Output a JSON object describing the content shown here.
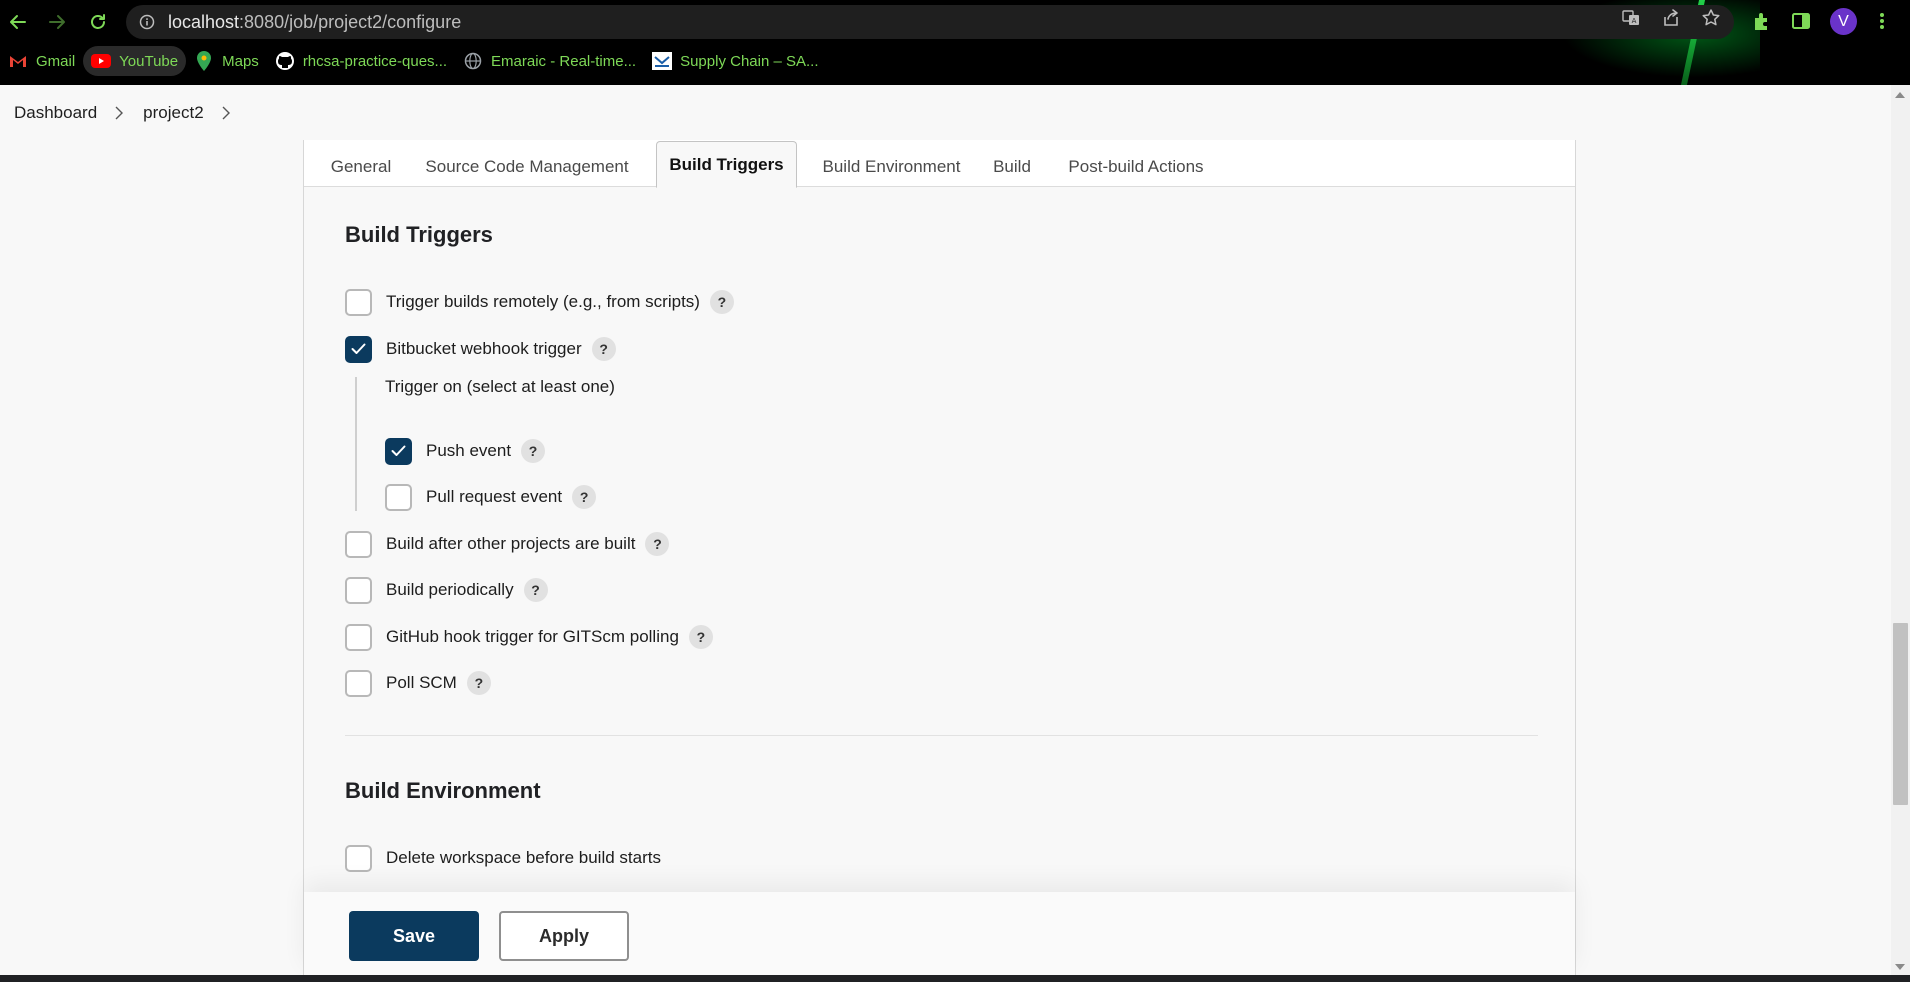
{
  "browser": {
    "url_host": "localhost",
    "url_rest": ":8080/job/project2/configure",
    "avatar_letter": "V",
    "icons": [
      "back-arrow-icon",
      "forward-arrow-icon",
      "reload-icon",
      "info-icon",
      "translate-icon",
      "share-icon",
      "star-icon",
      "extensions-icon",
      "side-panel-icon",
      "menu-kebab-icon"
    ],
    "accent_color": "#7ed957"
  },
  "bookmarks": [
    {
      "label": "Gmail",
      "icon": "gmail-icon"
    },
    {
      "label": "YouTube",
      "icon": "youtube-icon"
    },
    {
      "label": "Maps",
      "icon": "maps-pin-icon"
    },
    {
      "label": "rhcsa-practice-ques...",
      "icon": "github-icon"
    },
    {
      "label": "Emaraic - Real-time...",
      "icon": "globe-icon"
    },
    {
      "label": "Supply Chain – SA...",
      "icon": "mail-envelope-icon"
    }
  ],
  "breadcrumb": {
    "items": [
      "Dashboard",
      "project2"
    ]
  },
  "tabs": [
    {
      "label": "General"
    },
    {
      "label": "Source Code Management"
    },
    {
      "label": "Build Triggers",
      "active": true
    },
    {
      "label": "Build Environment"
    },
    {
      "label": "Build"
    },
    {
      "label": "Post-build Actions"
    }
  ],
  "build_triggers": {
    "title": "Build Triggers",
    "options": [
      {
        "label": "Trigger builds remotely (e.g., from scripts)",
        "checked": false,
        "help": "?"
      },
      {
        "label": "Bitbucket webhook trigger",
        "checked": true,
        "help": "?"
      },
      {
        "label": "Build after other projects are built",
        "checked": false,
        "help": "?"
      },
      {
        "label": "Build periodically",
        "checked": false,
        "help": "?"
      },
      {
        "label": "GitHub hook trigger for GITScm polling",
        "checked": false,
        "help": "?"
      },
      {
        "label": "Poll SCM",
        "checked": false,
        "help": "?"
      }
    ],
    "bitbucket": {
      "sublabel": "Trigger on (select at least one)",
      "events": [
        {
          "label": "Push event",
          "checked": true,
          "help": "?"
        },
        {
          "label": "Pull request event",
          "checked": false,
          "help": "?"
        }
      ]
    }
  },
  "build_environment": {
    "title": "Build Environment",
    "options": [
      {
        "label": "Delete workspace before build starts",
        "checked": false
      }
    ]
  },
  "actions": {
    "save": "Save",
    "apply": "Apply"
  },
  "colors": {
    "primary_button": "#0b3a5e",
    "checkbox_checked": "#0b3a5e"
  }
}
